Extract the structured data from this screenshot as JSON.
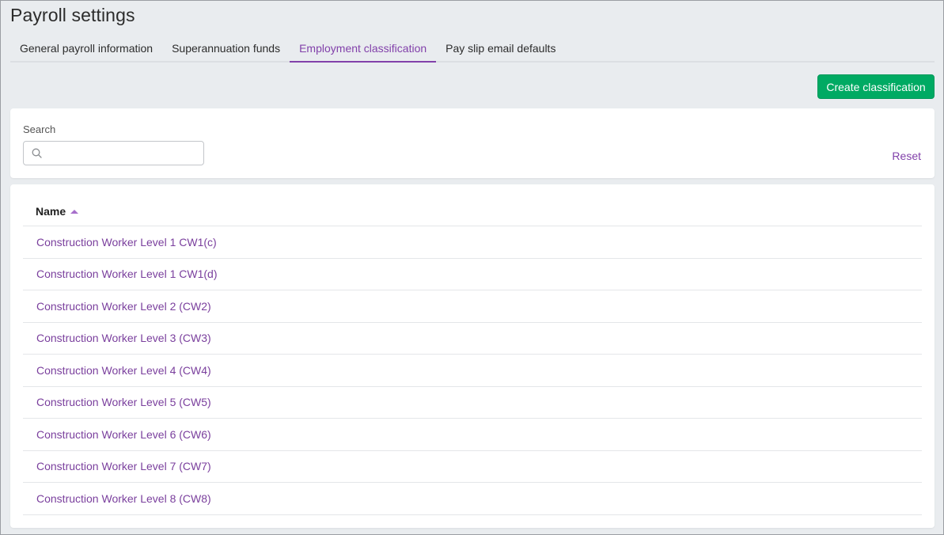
{
  "page": {
    "title": "Payroll settings"
  },
  "tabs": [
    {
      "label": "General payroll information",
      "active": false
    },
    {
      "label": "Superannuation funds",
      "active": false
    },
    {
      "label": "Employment classification",
      "active": true
    },
    {
      "label": "Pay slip email defaults",
      "active": false
    }
  ],
  "toolbar": {
    "create_label": "Create classification"
  },
  "filter": {
    "search_label": "Search",
    "search_value": "",
    "search_placeholder": "",
    "search_icon": "search-icon",
    "reset_label": "Reset"
  },
  "table": {
    "columns": [
      {
        "label": "Name",
        "sort": "ascending",
        "sort_icon": "caret-up-icon"
      }
    ],
    "rows": [
      "Construction Worker Level 1 CW1(c)",
      "Construction Worker Level 1 CW1(d)",
      "Construction Worker Level 2 (CW2)",
      "Construction Worker Level 3 (CW3)",
      "Construction Worker Level 4 (CW4)",
      "Construction Worker Level 5 (CW5)",
      "Construction Worker Level 6 (CW6)",
      "Construction Worker Level 7 (CW7)",
      "Construction Worker Level 8 (CW8)"
    ]
  },
  "colors": {
    "accent": "#8241aa",
    "primary_button": "#00aa63",
    "background": "#e9ecef",
    "link": "#7a3f9d"
  }
}
